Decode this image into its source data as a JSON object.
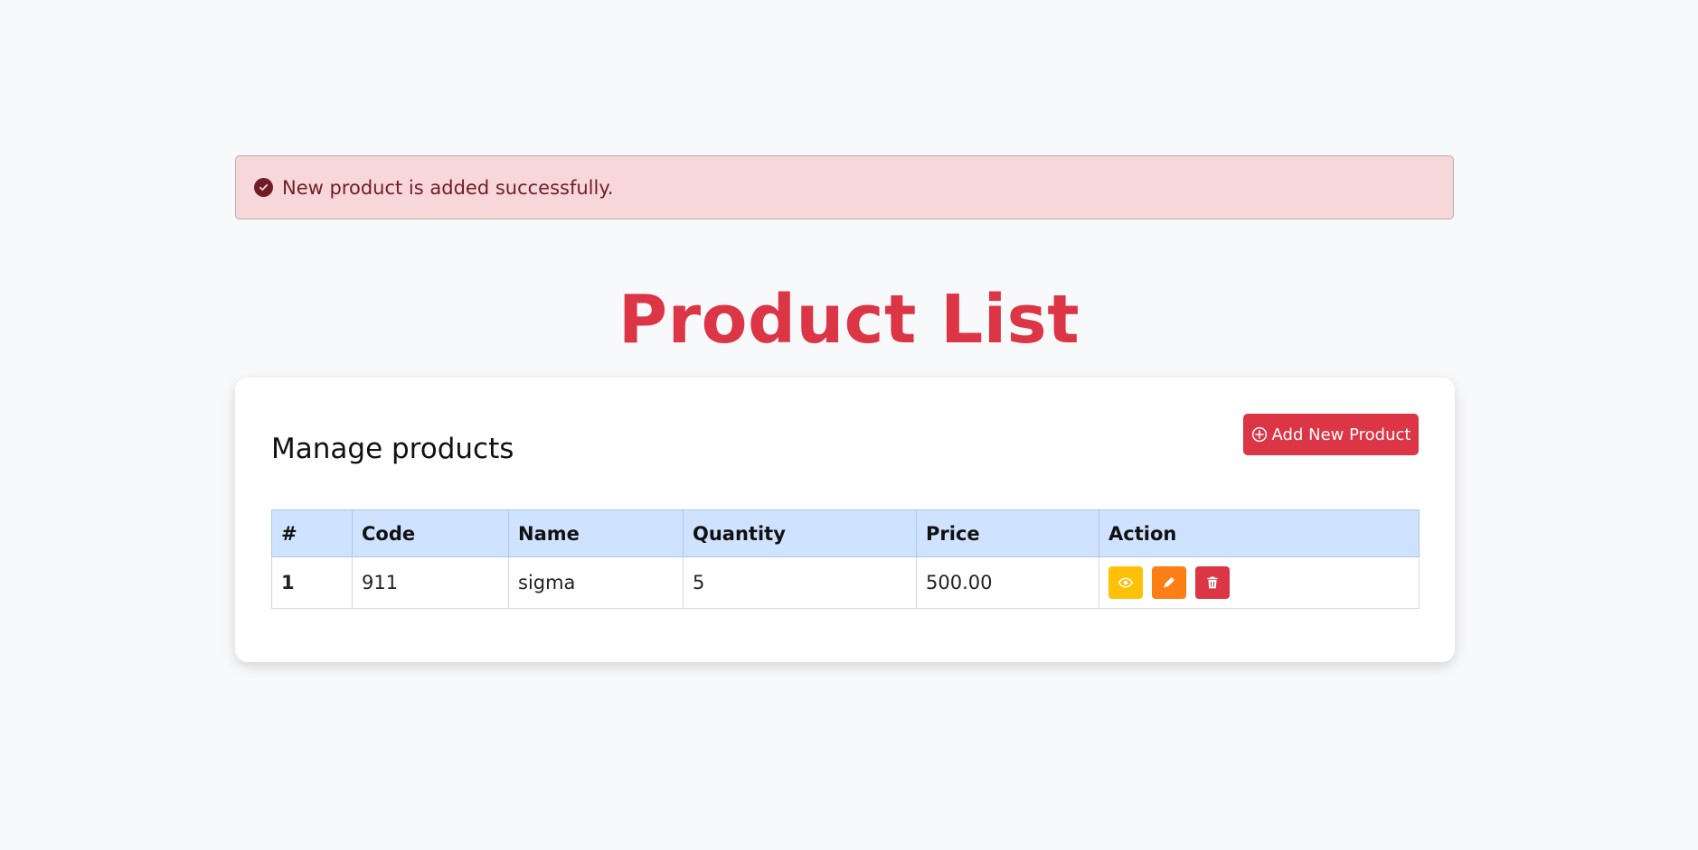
{
  "alert": {
    "message": "New product is added successfully.",
    "icon": "check-circle-icon",
    "background": "#f8d7da",
    "text_color": "#6f1d27"
  },
  "page": {
    "title": "Product List",
    "title_color": "#dc3545"
  },
  "card": {
    "title": "Manage products",
    "add_button": {
      "label": "Add New Product",
      "icon": "plus-circle-icon",
      "color": "#dc3545"
    }
  },
  "table": {
    "headers": [
      "#",
      "Code",
      "Name",
      "Quantity",
      "Price",
      "Action"
    ],
    "header_background": "#cfe2ff",
    "rows": [
      {
        "number": "1",
        "code": "911",
        "name": "sigma",
        "quantity": "5",
        "price": "500.00",
        "actions": [
          {
            "name": "view",
            "icon": "eye-icon",
            "color": "#ffc107"
          },
          {
            "name": "edit",
            "icon": "pencil-icon",
            "color": "#fd7e14"
          },
          {
            "name": "delete",
            "icon": "trash-icon",
            "color": "#dc3545"
          }
        ]
      }
    ]
  }
}
